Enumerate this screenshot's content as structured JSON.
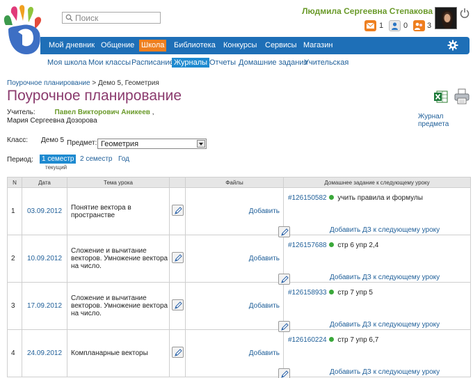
{
  "header": {
    "search_placeholder": "Поиск",
    "user_name": "Людмила Сергеевна Степакова",
    "badges": [
      {
        "icon": "mail-icon",
        "count": "1",
        "color": "#ee7f1f"
      },
      {
        "icon": "friends-icon",
        "count": "0",
        "color": "#ee7f1f"
      },
      {
        "icon": "community-icon",
        "count": "3",
        "color": "#ee7f1f"
      }
    ]
  },
  "nav": {
    "items": [
      "Мой дневник",
      "Общение",
      "Школа",
      "Библиотека",
      "Конкурсы",
      "Сервисы",
      "Магазин"
    ],
    "active": "Школа"
  },
  "subnav": {
    "items": [
      "Моя школа",
      "Мои классы",
      "Расписание",
      "Журналы",
      "Отчеты",
      "Домашние задания",
      "Учительская"
    ],
    "active": "Журналы"
  },
  "breadcrumb": {
    "link": "Поурочное планирование",
    "sep": ">",
    "current": "Демо 5, Геометрия"
  },
  "page_title": "Поурочное планирование",
  "journal_link": "Журнал предмета",
  "teacher": {
    "label": "Учитель:",
    "name1": "Павел Викторович Аникеев",
    "comma": ",",
    "name2": "Мария Сергеевна Дозорова"
  },
  "filters": {
    "class_label": "Класс:",
    "class_value": "Демо 5",
    "subject_label": "Предмет:",
    "subject_value": "Геометрия",
    "period_label": "Период:",
    "period_active": "1 семестр",
    "period_active_sub": "текущий",
    "period_2": "2 семестр",
    "period_3": "Год"
  },
  "table": {
    "headers": [
      "N",
      "Дата",
      "Тема урока",
      "",
      "Файлы",
      "Домашнее задание к следующему уроку"
    ],
    "add_file": "Добавить",
    "add_hw": "Добавить ДЗ к следующему уроку",
    "rows": [
      {
        "n": "1",
        "date": "03.09.2012",
        "topic": "Понятие вектора в пространстве",
        "hw_id": "#126150582",
        "hw_text": "учить правила и формулы"
      },
      {
        "n": "2",
        "date": "10.09.2012",
        "topic": "Сложение и вычитание векторов. Умножение вектора на число.",
        "hw_id": "#126157688",
        "hw_text": "стр 6 упр 2,4"
      },
      {
        "n": "3",
        "date": "17.09.2012",
        "topic": "Сложение и вычитание векторов. Умножение вектора на число.",
        "hw_id": "#126158933",
        "hw_text": "стр 7 упр 5"
      },
      {
        "n": "4",
        "date": "24.09.2012",
        "topic": "Компланарные векторы",
        "hw_id": "#126160224",
        "hw_text": "стр 7 упр 6,7"
      }
    ]
  }
}
